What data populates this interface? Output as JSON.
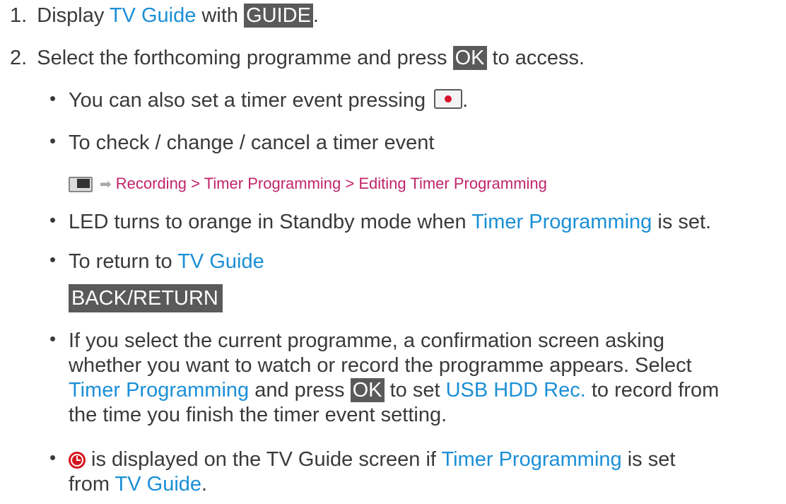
{
  "steps": [
    {
      "number": "1.",
      "pre": "Display ",
      "link": "TV Guide",
      "mid": " with ",
      "key": "GUIDE",
      "post": "."
    },
    {
      "number": "2.",
      "pre": "Select the forthcoming programme and press ",
      "key": "OK",
      "post": " to access."
    }
  ],
  "bullets": {
    "b1": {
      "text": "You can also set a timer event pressing ",
      "post": "."
    },
    "b2": {
      "text": "To check / change / cancel a timer event"
    },
    "path": "Recording > Timer Programming > Editing Timer Programming",
    "b3": {
      "pre": "LED turns to orange in Standby mode when ",
      "link": "Timer Programming",
      "post": " is set."
    },
    "b4": {
      "pre": "To return to ",
      "link": "TV Guide"
    },
    "back_key": "BACK/RETURN",
    "b5": {
      "line1": "If you select the current programme, a confirmation screen asking",
      "line2": "whether you want to watch or record the programme appears. Select",
      "line3_link1": "Timer Programming",
      "line3_mid": " and press ",
      "line3_key": "OK",
      "line3_mid2": " to set ",
      "line3_link2": "USB HDD Rec.",
      "line3_post": " to record from",
      "line4": "the time you finish the timer event setting."
    },
    "b6": {
      "pre": " is displayed on the TV Guide screen if ",
      "link": "Timer Programming",
      "post": " is set",
      "line2_pre": "from ",
      "line2_link": "TV Guide",
      "line2_post": "."
    }
  },
  "icons": {
    "rec_button": "record-button-icon",
    "menu": "tv-menu-icon",
    "arrow": "arrow-right-icon",
    "timer": "timer-clock-icon"
  },
  "colors": {
    "link": "#1b8fd6",
    "path": "#c0246a",
    "key_bg": "#5a5a5a",
    "record": "#d9122c"
  }
}
